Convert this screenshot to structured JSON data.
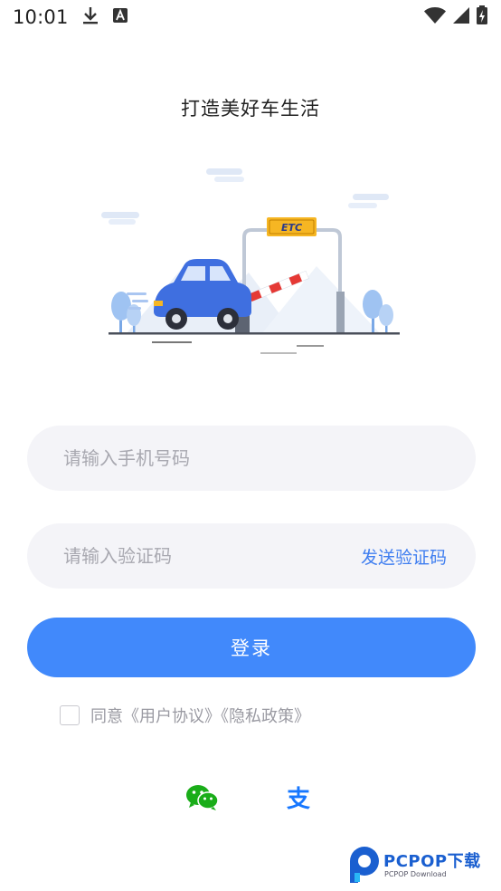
{
  "status_bar": {
    "time": "10:01",
    "icons": [
      "download-icon",
      "a-icon",
      "wifi-icon",
      "signal-icon",
      "battery-icon"
    ]
  },
  "tagline": "打造美好车生活",
  "hero": {
    "etc_sign": "ETC"
  },
  "login": {
    "phone_placeholder": "请输入手机号码",
    "code_placeholder": "请输入验证码",
    "send_code_label": "发送验证码",
    "login_label": "登录",
    "agreement": {
      "checked": false,
      "text": "同意《用户协议》《隐私政策》"
    }
  },
  "social": {
    "icons": [
      "wechat-icon",
      "alipay-icon"
    ],
    "wechat_color": "#1aad19",
    "alipay_color": "#1677ff",
    "alipay_glyph": "支"
  },
  "watermark": {
    "name": "PCPOP下载",
    "sub": "PCPOP Download"
  },
  "colors": {
    "primary": "#4189fb",
    "input_bg": "#f4f4f8",
    "placeholder": "#a8a8b0"
  }
}
